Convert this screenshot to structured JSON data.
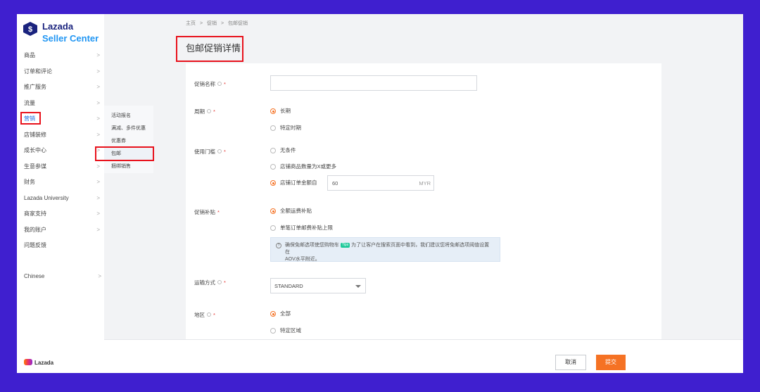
{
  "brand": {
    "name_line1": "Lazada",
    "name_line2": "Seller Center",
    "footer_logo": "Lazada",
    "colors": {
      "navy": "#1a237e",
      "blue": "#2196f3",
      "orange": "#f57224",
      "highlight": "#e8121c"
    }
  },
  "sidebar": {
    "items": [
      {
        "label": "商品"
      },
      {
        "label": "订单和评论"
      },
      {
        "label": "推广服务"
      },
      {
        "label": "流量"
      },
      {
        "label": "营销"
      },
      {
        "label": "店铺装修"
      },
      {
        "label": "成长中心"
      },
      {
        "label": "生意参谋"
      },
      {
        "label": "财务"
      },
      {
        "label": "Lazada University"
      },
      {
        "label": "商家支持"
      },
      {
        "label": "我的账户"
      },
      {
        "label": "问题反馈"
      }
    ],
    "language": "Chinese"
  },
  "submenu": {
    "items": [
      {
        "label": "活动报名"
      },
      {
        "label": "满减、多件优惠"
      },
      {
        "label": "优惠券"
      },
      {
        "label": "包邮"
      },
      {
        "label": "捆绑销售"
      }
    ]
  },
  "breadcrumb": [
    "主页",
    ">",
    "促销",
    ">",
    "包邮促销"
  ],
  "page_title": "包邮促销详情",
  "form": {
    "promo_name": {
      "label": "促销名称",
      "required": "*",
      "value": ""
    },
    "period": {
      "label": "周期",
      "required": "*",
      "options": [
        "长期",
        "特定时期"
      ],
      "selected": "长期"
    },
    "threshold": {
      "label": "使用门槛",
      "required": "*",
      "options": [
        "无条件",
        "店铺商品数量为X或更多",
        "店铺订单金额自"
      ],
      "selected": "店铺订单金额自",
      "amount": "60",
      "currency": "MYR"
    },
    "subsidy": {
      "label": "促销补贴",
      "required": "*",
      "options": [
        "全额运费补贴",
        "单笔订单邮费补贴上限"
      ],
      "selected": "全额运费补贴",
      "tip_prefix": "确保免邮选项使您购物车",
      "tip_badge": "Tips",
      "tip_suffix": "为了让客户在搜索页面中看到，我们建议您将免邮选项阈值设置在",
      "tip_line2": "AOV水平附近。"
    },
    "shipping": {
      "label": "运输方式",
      "required": "*",
      "value": "STANDARD"
    },
    "region": {
      "label": "地区",
      "required": "*",
      "options": [
        "全部",
        "特定区域"
      ],
      "selected": "全部"
    }
  },
  "footer": {
    "cancel": "取消",
    "submit": "提交"
  }
}
